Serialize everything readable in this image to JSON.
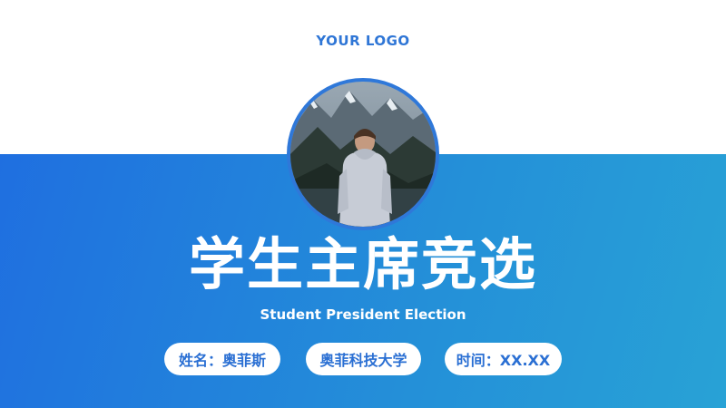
{
  "logo": {
    "text": "YOUR LOGO"
  },
  "hero": {
    "title": "学生主席竞选",
    "subtitle": "Student President Election"
  },
  "info": {
    "name": "姓名：奥菲斯",
    "school": "奥菲科技大学",
    "time": "时间：XX.XX"
  },
  "colors": {
    "accent": "#2f76d6",
    "band_start": "#1f6fe0",
    "band_end": "#28a2d6",
    "pill_text": "#2a6fd3"
  },
  "photo": {
    "icon": "person-mountain-photo"
  }
}
